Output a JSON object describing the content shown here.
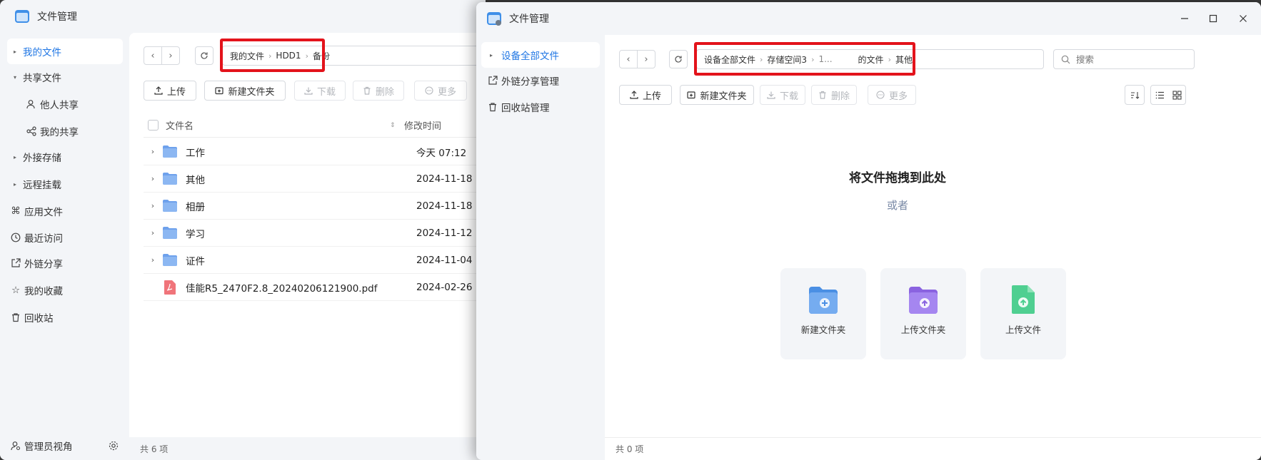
{
  "left_window": {
    "title": "文件管理",
    "sidebar": {
      "items": [
        {
          "label": "我的文件"
        },
        {
          "label": "共享文件"
        },
        {
          "label": "他人共享"
        },
        {
          "label": "我的共享"
        },
        {
          "label": "外接存储"
        },
        {
          "label": "远程挂载"
        },
        {
          "label": "应用文件"
        },
        {
          "label": "最近访问"
        },
        {
          "label": "外链分享"
        },
        {
          "label": "我的收藏"
        },
        {
          "label": "回收站"
        }
      ],
      "footer_label": "管理员视角"
    },
    "breadcrumb": [
      "我的文件",
      "HDD1",
      "备份"
    ],
    "toolbar": {
      "upload": "上传",
      "new_folder": "新建文件夹",
      "download": "下载",
      "delete": "删除",
      "more": "更多"
    },
    "columns": {
      "name": "文件名",
      "modified": "修改时间"
    },
    "rows": [
      {
        "name": "工作",
        "date": "今天 07:12",
        "type": "folder"
      },
      {
        "name": "其他",
        "date": "2024-11-18",
        "type": "folder"
      },
      {
        "name": "相册",
        "date": "2024-11-18",
        "type": "folder"
      },
      {
        "name": "学习",
        "date": "2024-11-12",
        "type": "folder"
      },
      {
        "name": "证件",
        "date": "2024-11-04",
        "type": "folder"
      },
      {
        "name": "佳能R5_2470F2.8_20240206121900.pdf",
        "date": "2024-02-26",
        "type": "pdf"
      }
    ],
    "footer": "共 6 项"
  },
  "right_window": {
    "title": "文件管理",
    "sidebar": {
      "items": [
        {
          "label": "设备全部文件"
        },
        {
          "label": "外链分享管理"
        },
        {
          "label": "回收站管理"
        }
      ]
    },
    "breadcrumb": [
      "设备全部文件",
      "存储空间3",
      "1...",
      "的文件",
      "其他"
    ],
    "search": {
      "placeholder": "搜索"
    },
    "toolbar": {
      "upload": "上传",
      "new_folder": "新建文件夹",
      "download": "下载",
      "delete": "删除",
      "more": "更多"
    },
    "empty": {
      "drag_text": "将文件拖拽到此处",
      "or_text": "或者",
      "cards": [
        {
          "label": "新建文件夹",
          "icon": "new-folder-icon"
        },
        {
          "label": "上传文件夹",
          "icon": "upload-folder-icon"
        },
        {
          "label": "上传文件",
          "icon": "upload-file-icon"
        }
      ]
    },
    "footer": "共 0 项"
  },
  "colors": {
    "accent": "#1f76e4",
    "highlight_box": "#e3131b",
    "folder": "#6ea1ec",
    "pdf": "#f0747a"
  }
}
